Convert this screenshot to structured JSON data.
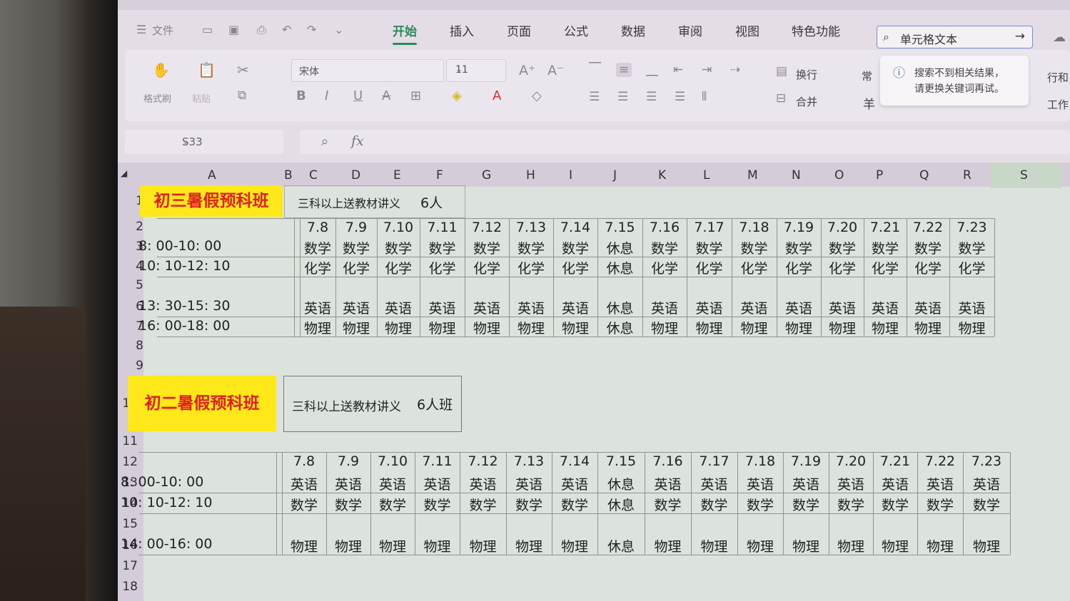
{
  "quick_access": {
    "file": "文件"
  },
  "menu": [
    "开始",
    "插入",
    "页面",
    "公式",
    "数据",
    "审阅",
    "视图",
    "特色功能"
  ],
  "search": {
    "value": "单元格文本"
  },
  "tooltip": {
    "line1": "搜索不到相关结果，",
    "line2": "请更换关键词再试。"
  },
  "ribbon": {
    "format_painter": "格式刷",
    "paste": "粘贴",
    "font_name": "宋体",
    "font_size": "11",
    "wrap": "换行",
    "merge": "合并",
    "number_format": "常",
    "yen": "羊",
    "rows_cols": "行和",
    "worksheet": "工作"
  },
  "name_box": "S33",
  "columns": [
    "A",
    "B",
    "C",
    "D",
    "E",
    "F",
    "G",
    "H",
    "I",
    "J",
    "K",
    "L",
    "M",
    "N",
    "O",
    "P",
    "Q",
    "R",
    "S"
  ],
  "rows": [
    "1",
    "2",
    "3",
    "4",
    "5",
    "6",
    "7",
    "8",
    "9",
    "10",
    "11",
    "12",
    "13",
    "14",
    "15",
    "16",
    "17",
    "18"
  ],
  "block1": {
    "title": "初三暑假预科班",
    "note": "三科以上送教材讲义",
    "size": "6人",
    "dates": [
      "7.8",
      "7.9",
      "7.10",
      "7.11",
      "7.12",
      "7.13",
      "7.14",
      "7.15",
      "7.16",
      "7.17",
      "7.18",
      "7.19",
      "7.20",
      "7.21",
      "7.22",
      "7.23"
    ],
    "slots": [
      {
        "time": "8: 00-10: 00",
        "subjects": [
          "数学",
          "数学",
          "数学",
          "数学",
          "数学",
          "数学",
          "数学",
          "休息",
          "数学",
          "数学",
          "数学",
          "数学",
          "数学",
          "数学",
          "数学",
          "数学"
        ]
      },
      {
        "time": "10: 10-12: 10",
        "subjects": [
          "化学",
          "化学",
          "化学",
          "化学",
          "化学",
          "化学",
          "化学",
          "休息",
          "化学",
          "化学",
          "化学",
          "化学",
          "化学",
          "化学",
          "化学",
          "化学"
        ]
      },
      {
        "time": "13: 30-15: 30",
        "subjects": [
          "英语",
          "英语",
          "英语",
          "英语",
          "英语",
          "英语",
          "英语",
          "休息",
          "英语",
          "英语",
          "英语",
          "英语",
          "英语",
          "英语",
          "英语",
          "英语"
        ]
      },
      {
        "time": "16: 00-18: 00",
        "subjects": [
          "物理",
          "物理",
          "物理",
          "物理",
          "物理",
          "物理",
          "物理",
          "休息",
          "物理",
          "物理",
          "物理",
          "物理",
          "物理",
          "物理",
          "物理",
          "物理"
        ]
      }
    ]
  },
  "block2": {
    "title": "初二暑假预科班",
    "note": "三科以上送教材讲义",
    "size": "6人班",
    "dates": [
      "7.8",
      "7.9",
      "7.10",
      "7.11",
      "7.12",
      "7.13",
      "7.14",
      "7.15",
      "7.16",
      "7.17",
      "7.18",
      "7.19",
      "7.20",
      "7.21",
      "7.22",
      "7.23"
    ],
    "slots": [
      {
        "time": "8: 00-10: 00",
        "subjects": [
          "英语",
          "英语",
          "英语",
          "英语",
          "英语",
          "英语",
          "英语",
          "休息",
          "英语",
          "英语",
          "英语",
          "英语",
          "英语",
          "英语",
          "英语",
          "英语"
        ]
      },
      {
        "time": "10: 10-12: 10",
        "subjects": [
          "数学",
          "数学",
          "数学",
          "数学",
          "数学",
          "数学",
          "数学",
          "休息",
          "数学",
          "数学",
          "数学",
          "数学",
          "数学",
          "数学",
          "数学",
          "数学"
        ]
      },
      {
        "time": "14: 00-16: 00",
        "subjects": [
          "物理",
          "物理",
          "物理",
          "物理",
          "物理",
          "物理",
          "物理",
          "休息",
          "物理",
          "物理",
          "物理",
          "物理",
          "物理",
          "物理",
          "物理",
          "物理"
        ]
      }
    ]
  }
}
